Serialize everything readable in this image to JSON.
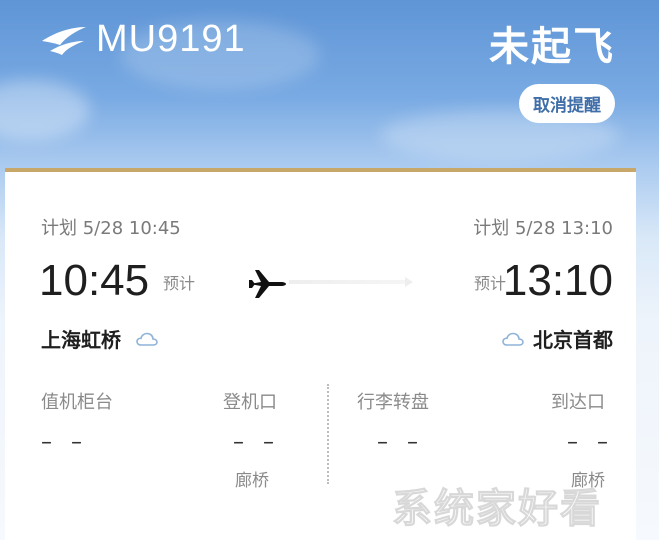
{
  "header": {
    "flight_number": "MU9191",
    "status": "未起飞",
    "cancel_reminder_label": "取消提醒"
  },
  "departure": {
    "scheduled": "计划 5/28 10:45",
    "time": "10:45",
    "estimate_label": "预计",
    "airport": "上海虹桥",
    "weather_icon": "cloud-icon"
  },
  "arrival": {
    "scheduled": "计划 5/28 13:10",
    "time": "13:10",
    "estimate_label": "预计",
    "airport": "北京首都",
    "weather_icon": "cloud-icon"
  },
  "details": {
    "checkin": {
      "label": "值机柜台",
      "value": "– –"
    },
    "gate": {
      "label": "登机口",
      "value": "– –",
      "sub": "廊桥"
    },
    "baggage": {
      "label": "行李转盘",
      "value": "– –"
    },
    "arrival_gate": {
      "label": "到达口",
      "value": "– –",
      "sub": "廊桥"
    }
  },
  "watermark": "系统家好看",
  "colors": {
    "sky_top": "#5f95d6",
    "card_accent": "#c8a86a",
    "button_text": "#3f6ea8",
    "weather_icon": "#8fb3d9"
  }
}
